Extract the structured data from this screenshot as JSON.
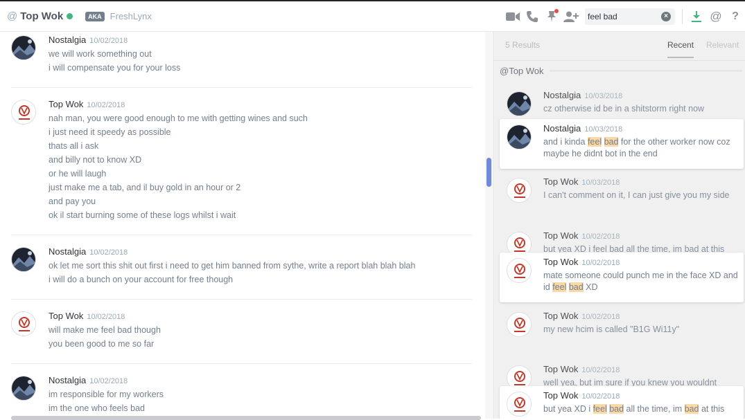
{
  "header": {
    "at_symbol": "@",
    "title": "Top Wok",
    "aka_label": "AKA",
    "nickname": "FreshLynx",
    "status_color": "#43b581",
    "icons": [
      "video-call-icon",
      "voice-call-icon",
      "pinned-messages-icon",
      "add-friend-icon",
      "download-icon",
      "mentions-icon",
      "help-icon"
    ]
  },
  "search": {
    "value": "feel bad",
    "clear_label": "×"
  },
  "chat": {
    "groups": [
      {
        "author": "Nostalgia",
        "timestamp": "10/02/2018",
        "lines": [
          "we will work something out",
          "i will compensate you for your loss"
        ]
      },
      {
        "author": "Top Wok",
        "timestamp": "10/02/2018",
        "lines": [
          "nah man, you were good enough to me with getting wines and such",
          "i just need it speedy as possible",
          "thats all i ask",
          "and billy not to know XD",
          "or he will laugh",
          "just make me a tab, and il buy gold in an hour or 2",
          "and pay you",
          "ok il start burning some of these logs whilst i wait"
        ]
      },
      {
        "author": "Nostalgia",
        "timestamp": "10/02/2018",
        "lines": [
          "ok let me sort this shit out first i need to get him banned from sythe, write a report blah blah blah",
          "i will do a bunch on your account for free though"
        ]
      },
      {
        "author": "Top Wok",
        "timestamp": "10/02/2018",
        "lines": [
          "will make me feel bad though",
          "you been good to me so far"
        ]
      },
      {
        "author": "Nostalgia",
        "timestamp": "10/02/2018",
        "lines": [
          "im responsible for my workers",
          "im the one who feels bad"
        ]
      }
    ]
  },
  "results": {
    "count_label": "5 Results",
    "tab_recent": "Recent",
    "tab_relevant": "Relevant",
    "channel_label": "@Top Wok",
    "items": [
      {
        "author": "Nostalgia",
        "timestamp": "10/03/2018",
        "text": "cz otherwise id be in a shitstorm right now"
      },
      {
        "author": "Nostalgia",
        "timestamp": "10/03/2018",
        "pre": "and i kinda ",
        "hl1": "feel",
        "mid": " ",
        "hl2": "bad",
        "post": " for the other worker now coz maybe he didnt bot in the end"
      },
      {
        "author": "Top Wok",
        "timestamp": "10/03/2018",
        "text": "I can't comment on it, I can just give you my side of things"
      },
      {
        "author": "Top Wok",
        "timestamp": "10/02/2018",
        "text": "but yea XD i feel bad all the time, im bad at this"
      },
      {
        "author": "Top Wok",
        "timestamp": "10/02/2018",
        "pre": "mate someone could punch me in the face XD and id ",
        "hl1": "feel",
        "mid": " ",
        "hl2": "bad",
        "post": " XD"
      },
      {
        "author": "Top Wok",
        "timestamp": "10/02/2018",
        "text": "my new hcim is called \"B1G Wi11y\""
      },
      {
        "author": "Top Wok",
        "timestamp": "10/02/2018",
        "text": "well yea, but im sure if you knew you wouldnt"
      },
      {
        "author": "Top Wok",
        "timestamp": "10/02/2018",
        "pre": "but yea XD i ",
        "hl1": "feel",
        "mid": " ",
        "hl2": "bad",
        "post": " all the time, im ",
        "hl3": "bad",
        "post2": " at this"
      }
    ]
  },
  "colors": {
    "accent": "#7289da",
    "highlight": "#fad9a6",
    "online": "#43b581",
    "notification": "#f04747"
  }
}
